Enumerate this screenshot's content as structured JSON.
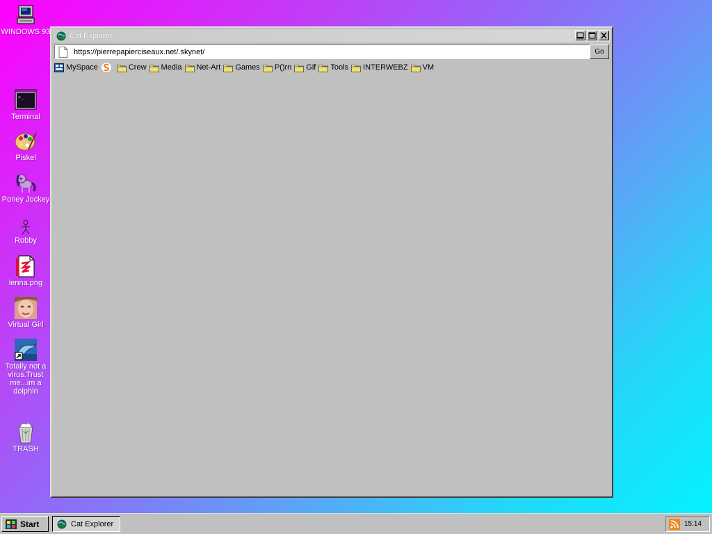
{
  "desktop": {
    "icons": [
      {
        "label": "WINDOWS 93"
      },
      {
        "label": "Terminal"
      },
      {
        "label": "Piskel"
      },
      {
        "label": "Poney Jockey"
      },
      {
        "label": "Robby"
      },
      {
        "label": "lenna.png"
      },
      {
        "label": "Virtual Girl"
      },
      {
        "label": "Totally not a virus.Trust me...im a dolphin"
      },
      {
        "label": "TRASH"
      }
    ]
  },
  "window": {
    "title": "Cat Explorer",
    "address": "https://pierrepapierciseaux.net/.skynet/",
    "go_label": "Go",
    "bookmarks": [
      {
        "label": "MySpace",
        "icon": "myspace-icon"
      },
      {
        "label": "",
        "icon": "s-logo-icon"
      },
      {
        "label": "Crew",
        "icon": "folder-icon"
      },
      {
        "label": "Media",
        "icon": "folder-icon"
      },
      {
        "label": "Net-Art",
        "icon": "folder-icon"
      },
      {
        "label": "Games",
        "icon": "folder-icon"
      },
      {
        "label": "P()rn",
        "icon": "folder-icon"
      },
      {
        "label": "Gif",
        "icon": "folder-icon"
      },
      {
        "label": "Tools",
        "icon": "folder-icon"
      },
      {
        "label": "INTERWEBZ",
        "icon": "folder-icon"
      },
      {
        "label": "VM",
        "icon": "folder-icon"
      }
    ]
  },
  "taskbar": {
    "start_label": "Start",
    "tasks": [
      {
        "label": "Cat Explorer"
      }
    ],
    "clock": "15:14"
  },
  "colors": {
    "desktop_gradient_start": "#ff00ff",
    "desktop_gradient_end": "#00f5ff",
    "window_gray": "#c0c0c0"
  }
}
